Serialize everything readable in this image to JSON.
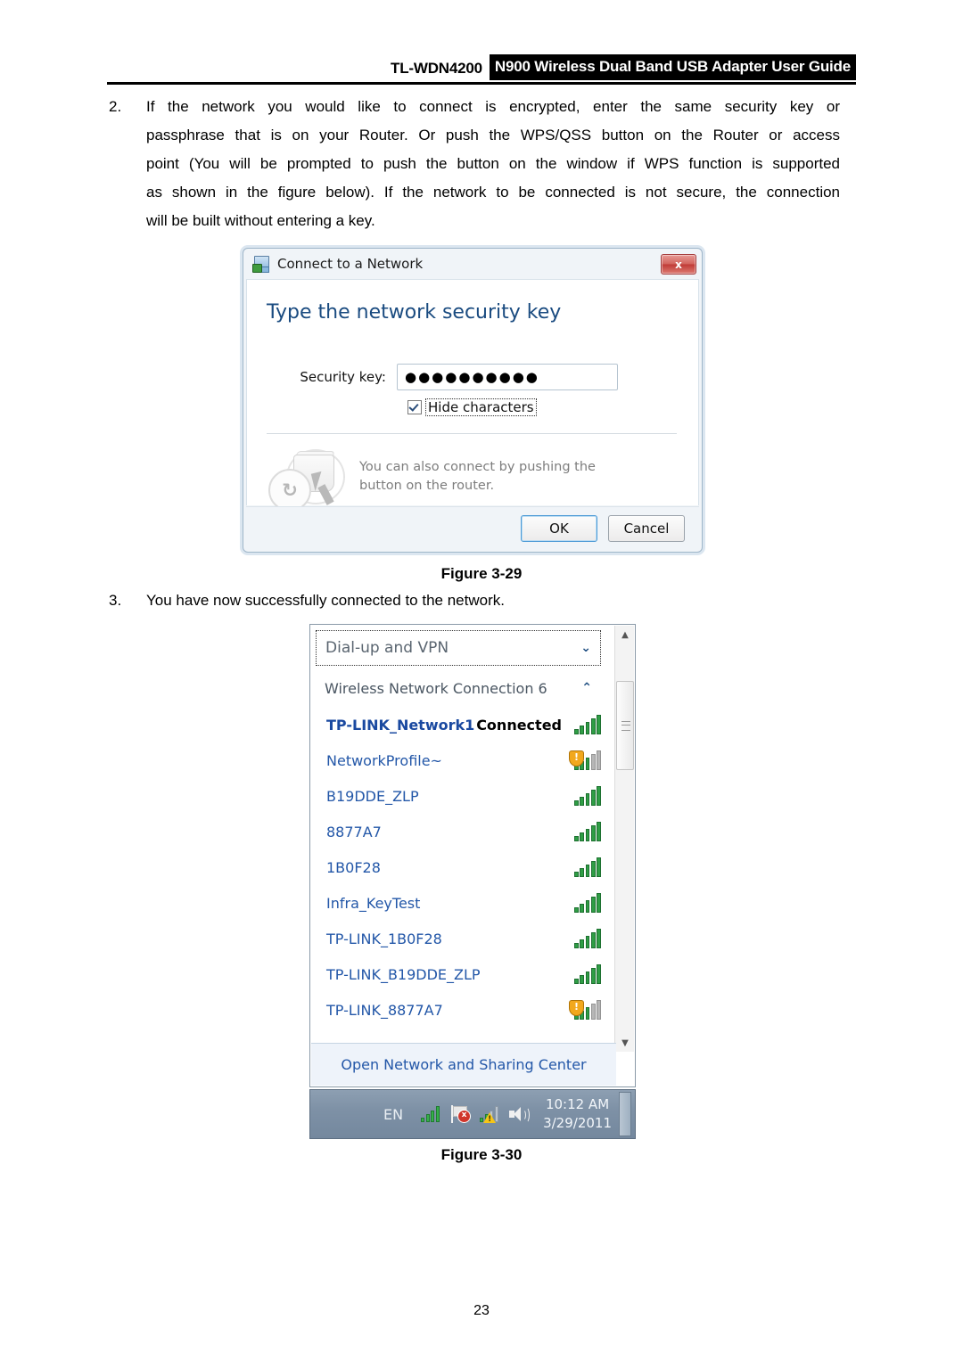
{
  "header": {
    "model": "TL-WDN4200",
    "title": "N900 Wireless Dual Band USB Adapter User Guide"
  },
  "steps": [
    {
      "number": "2.",
      "lines": [
        "If the network you would like to connect is encrypted, enter the same security key or",
        "passphrase that is on your Router. Or push the WPS/QSS button on the Router or access",
        "point (You will be prompted to push the button on the window if WPS function is supported",
        "as shown in the figure below). If the network to be connected is not secure, the connection",
        "will be built without entering a key."
      ]
    },
    {
      "number": "3.",
      "text": "You have now successfully connected to the network."
    }
  ],
  "captions": {
    "fig_29": "Figure 3-29",
    "fig_30": "Figure 3-30"
  },
  "page_number": "23",
  "dialog": {
    "title": "Connect to a Network",
    "close_label": "x",
    "heading": "Type the network security key",
    "security_key_label": "Security key:",
    "security_key_value": "●●●●●●●●●●",
    "hide_characters_label": "Hide characters",
    "wps_badge_glyph": "↻",
    "wps_text_line1": "You can also connect by pushing the",
    "wps_text_line2": "button on the router.",
    "ok_label": "OK",
    "cancel_label": "Cancel"
  },
  "flyout": {
    "dialup_label": "Dial-up and VPN",
    "dialup_chevron": "⌄",
    "connection_label": "Wireless Network Connection 6",
    "connection_chevron": "⌃",
    "networks": [
      {
        "name": "TP-LINK_Network1",
        "status": "Connected",
        "bold": true,
        "secured": false,
        "dim": false
      },
      {
        "name": "NetworkProfile~",
        "status": "",
        "bold": false,
        "secured": true,
        "dim": true
      },
      {
        "name": "B19DDE_ZLP",
        "status": "",
        "bold": false,
        "secured": false,
        "dim": false
      },
      {
        "name": "8877A7",
        "status": "",
        "bold": false,
        "secured": false,
        "dim": false
      },
      {
        "name": "1B0F28",
        "status": "",
        "bold": false,
        "secured": false,
        "dim": false
      },
      {
        "name": "Infra_KeyTest",
        "status": "",
        "bold": false,
        "secured": false,
        "dim": false
      },
      {
        "name": "TP-LINK_1B0F28",
        "status": "",
        "bold": false,
        "secured": false,
        "dim": false
      },
      {
        "name": "TP-LINK_B19DDE_ZLP",
        "status": "",
        "bold": false,
        "secured": false,
        "dim": false
      },
      {
        "name": "TP-LINK_8877A7",
        "status": "",
        "bold": false,
        "secured": true,
        "dim": true
      }
    ],
    "open_network_center": "Open Network and Sharing Center",
    "scroll_up_glyph": "▲",
    "scroll_down_glyph": "▼",
    "taskbar": {
      "language": "EN",
      "time": "10:12 AM",
      "date": "3/29/2011",
      "shield_glyph": "!"
    }
  },
  "colors": {
    "link_blue": "#2357a8",
    "heading_blue": "#1a4b80",
    "signal_green": "#2f9e45",
    "shield_orange": "#f2a81d",
    "close_red": "#c03b36"
  }
}
